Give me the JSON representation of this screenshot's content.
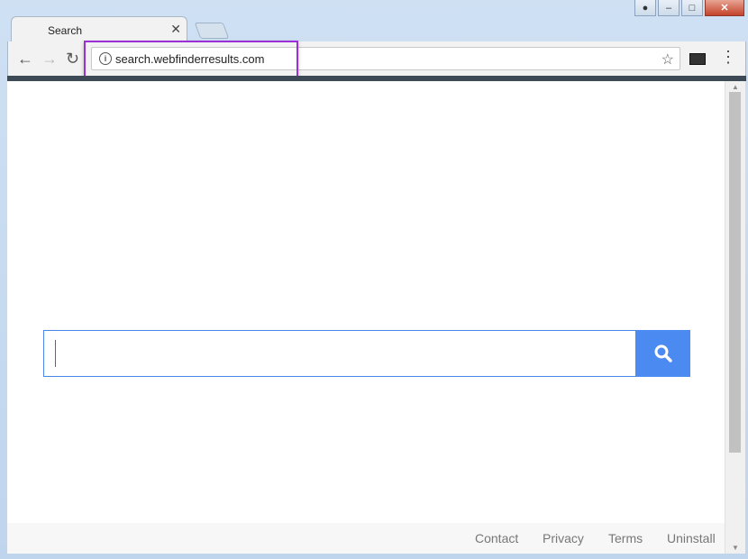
{
  "tab": {
    "title": "Search"
  },
  "toolbar": {
    "url": "search.webfinderresults.com"
  },
  "page": {
    "search": {
      "placeholder": "",
      "value": ""
    },
    "footer": {
      "links": [
        "Contact",
        "Privacy",
        "Terms",
        "Uninstall"
      ]
    }
  },
  "colors": {
    "accent": "#3d4a56",
    "search_button": "#4b8af0",
    "highlight": "#9b30d9"
  },
  "icons": [
    "user-icon",
    "minimize-icon",
    "maximize-icon",
    "close-icon",
    "back-icon",
    "forward-icon",
    "reload-icon",
    "info-icon",
    "star-icon",
    "cast-icon",
    "menu-icon",
    "search-icon"
  ]
}
